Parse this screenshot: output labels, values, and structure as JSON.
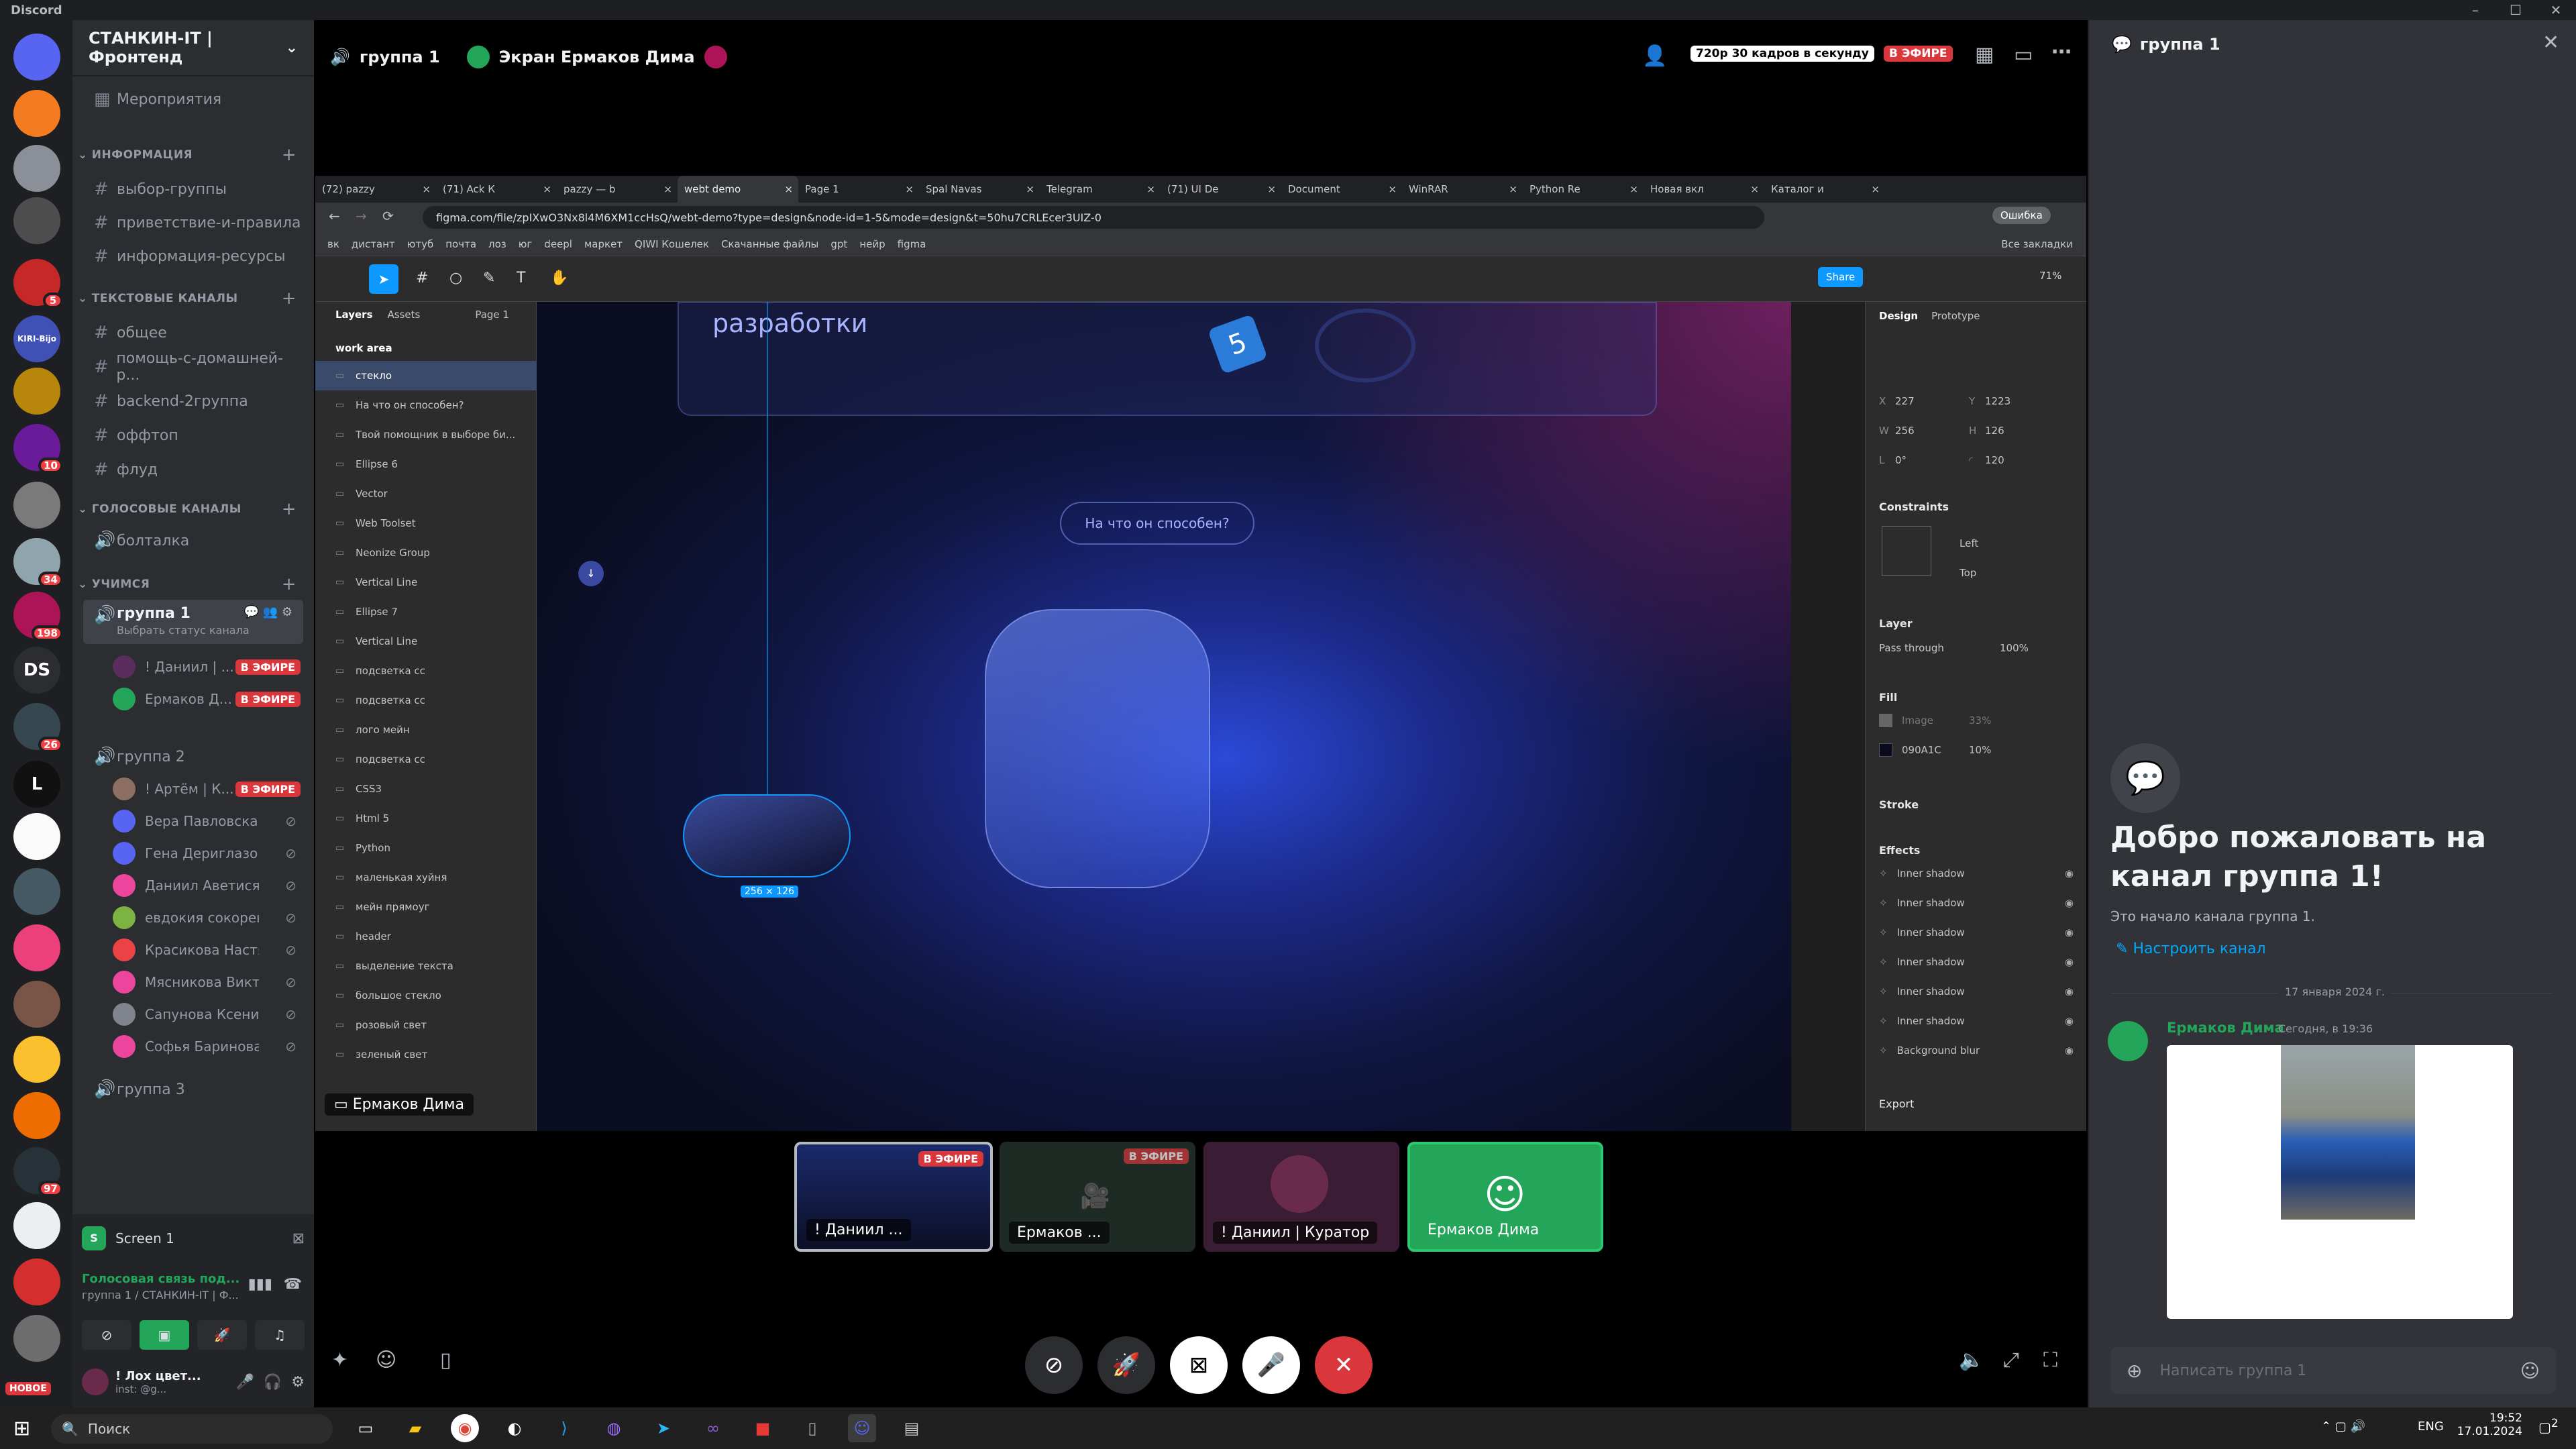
{
  "window": {
    "title": "Discord"
  },
  "colors": {
    "accent": "#5865f2",
    "live": "#da373c",
    "green": "#23a55a",
    "bg": "#313338"
  },
  "guilds": [
    {
      "label": "",
      "badge": "",
      "color": "#5865f2",
      "icon": "discord-icon"
    },
    {
      "label": "",
      "badge": "",
      "color": "#f47b20"
    },
    {
      "label": "",
      "badge": "",
      "color": "#8a8f98"
    },
    {
      "label": "",
      "badge": "",
      "color": "#4e4e4e"
    },
    {
      "label": "",
      "badge": "5",
      "color": "#c62828"
    },
    {
      "label": "KIRI-Bijo",
      "badge": "",
      "color": "#3f51b5"
    },
    {
      "label": "",
      "badge": "",
      "color": "#b8860b"
    },
    {
      "label": "",
      "badge": "10",
      "color": "#6a1b9a"
    },
    {
      "label": "",
      "badge": "",
      "color": "#7a7a7a"
    },
    {
      "label": "",
      "badge": "34",
      "color": "#90a4ae"
    },
    {
      "label": "",
      "badge": "198",
      "color": "#ad1457"
    },
    {
      "label": "DS",
      "badge": "",
      "color": "#2b2d31"
    },
    {
      "label": "",
      "badge": "26",
      "color": "#37474f"
    },
    {
      "label": "L",
      "badge": "",
      "color": "#111111"
    },
    {
      "label": "",
      "badge": "",
      "color": "#fafafa"
    },
    {
      "label": "",
      "badge": "",
      "color": "#455a64"
    },
    {
      "label": "",
      "badge": "",
      "color": "#ec407a"
    },
    {
      "label": "",
      "badge": "",
      "color": "#795548"
    },
    {
      "label": "",
      "badge": "",
      "color": "#fbc02d"
    },
    {
      "label": "",
      "badge": "",
      "color": "#ef6c00"
    },
    {
      "label": "",
      "badge": "97",
      "color": "#263238"
    },
    {
      "label": "",
      "badge": "",
      "color": "#eceff1"
    },
    {
      "label": "",
      "badge": "",
      "color": "#d32f2f"
    },
    {
      "label": "",
      "badge": "",
      "color": "#6d6d6d"
    }
  ],
  "new_label": "НОВОЕ",
  "server": {
    "name": "СТАНКИН-IT | Фронтенд",
    "events": "Мероприятия",
    "categories": {
      "info": "ИНФОРМАЦИЯ",
      "text": "ТЕКСТОВЫЕ КАНАЛЫ",
      "voice": "ГОЛОСОВЫЕ КАНАЛЫ",
      "study": "УЧИМСЯ"
    },
    "info_channels": [
      "выбор-группы",
      "приветствие-и-правила",
      "информация-ресурсы"
    ],
    "text_channels": [
      "общее",
      "помощь-с-домашней-р...",
      "backend-2группа",
      "оффтоп",
      "флуд"
    ],
    "voice_channels": [
      "болталка"
    ],
    "group1": {
      "name": "группа 1",
      "status": "Выбрать статус канала"
    },
    "group1_users": [
      {
        "name": "! Даниил | ...",
        "live": "В ЭФИРЕ",
        "color": "#5a2d5c"
      },
      {
        "name": "Ермаков Д...",
        "live": "В ЭФИРЕ",
        "color": "#23a55a"
      }
    ],
    "group2": {
      "name": "группа 2"
    },
    "group2_users": [
      {
        "name": "! Артём | К...",
        "live": "В ЭФИРЕ",
        "color": "#8d6e63"
      },
      {
        "name": "Вера Павловская",
        "live": "",
        "color": "#5865f2"
      },
      {
        "name": "Гена Дериглазов",
        "live": "",
        "color": "#5865f2"
      },
      {
        "name": "Даниил Аветисян",
        "live": "",
        "color": "#eb459e"
      },
      {
        "name": "евдокия сокоренко",
        "live": "",
        "color": "#7cb342"
      },
      {
        "name": "Красикова Настя",
        "live": "",
        "color": "#ed4245"
      },
      {
        "name": "Мясникова Виктор...",
        "live": "",
        "color": "#eb459e"
      },
      {
        "name": "Сапунова Ксения",
        "live": "",
        "color": "#80848e"
      },
      {
        "name": "Софья Баринова",
        "live": "",
        "color": "#eb459e"
      }
    ],
    "group3": {
      "name": "группа 3"
    }
  },
  "screen_panel": {
    "title": "Screen 1"
  },
  "voice_status": {
    "title": "Голосовая связь под...",
    "sub": "группа 1 / СТАНКИН-IT | Ф..."
  },
  "user_panel": {
    "name": "! Лох цвет...",
    "status": "inst: @g..."
  },
  "stage": {
    "channel": "группа 1",
    "screen_title": "Экран Ермаков Дима",
    "quality": "720p 30 кадров в секунду",
    "live": "В ЭФИРЕ",
    "streamer_tag": "Ермаков Дима"
  },
  "browser": {
    "tabs": [
      "(72) pazzy",
      "(71) Ack К",
      "pazzy — b",
      "webt demo",
      "Page 1",
      "Spal Navas",
      "Telegram",
      "(71) UI De",
      "Document",
      "WinRAR",
      "Python Re",
      "Новая вкл",
      "Каталог и"
    ],
    "url": "figma.com/file/zpIXwO3Nx8l4M6XM1ccHsQ/webt-demo?type=design&node-id=1-5&mode=design&t=50hu7CRLEcer3UIZ-0",
    "profile_btn": "Ошибка",
    "bookmarks": [
      "вк",
      "дистант",
      "ютуб",
      "почта",
      "лоз",
      "юг",
      "deepl",
      "маркет",
      "QIWI Кошелек",
      "Скачанные файлы",
      "gpt",
      "нейр",
      "figma"
    ],
    "all_bookmarks": "Все закладки"
  },
  "figma": {
    "tabs": {
      "layers": "Layers",
      "assets": "Assets",
      "page": "Page 1"
    },
    "frame": "work area",
    "layers": [
      "стекло",
      "На что он способен?",
      "Твой помощник в выборе би...",
      "Ellipse 6",
      "Vector",
      "Web Toolset",
      "Neonize Group",
      "Vertical Line",
      "Ellipse 7",
      "Vertical Line",
      "подсветка сс",
      "подсветка сс",
      "лого мейн",
      "подсветка сс",
      "CSS3",
      "Html 5",
      "Python",
      "маленькая хуйня",
      "мейн прямоуг",
      "header",
      "выделение текста",
      "большое стекло",
      "розовый свет",
      "зеленый свет"
    ],
    "share": "Share",
    "zoom": "71%",
    "canvas_heading": "разработки",
    "canvas_pill": "На что он способен?",
    "size_label": "256 × 126",
    "design_tabs": {
      "design": "Design",
      "prototype": "Prototype"
    },
    "x": "227",
    "y": "1223",
    "w": "256",
    "h": "126",
    "rot": "0°",
    "radius": "120",
    "constraints": {
      "title": "Constraints",
      "h": "Left",
      "v": "Top"
    },
    "layer": {
      "title": "Layer",
      "mode": "Pass through",
      "opacity": "100%"
    },
    "fill": {
      "title": "Fill",
      "image": "Image",
      "image_pct": "33%",
      "hex": "090A1C",
      "pct": "10%"
    },
    "stroke": "Stroke",
    "effects": {
      "title": "Effects",
      "items": [
        "Inner shadow",
        "Inner shadow",
        "Inner shadow",
        "Inner shadow",
        "Inner shadow",
        "Inner shadow",
        "Background blur"
      ]
    },
    "export": "Export"
  },
  "tiles": [
    {
      "name": "! Даниил ...",
      "live": "В ЭФИРЕ"
    },
    {
      "name": "Ермаков ...",
      "live": "В ЭФИРЕ"
    },
    {
      "name": "! Даниил | Куратор",
      "live": ""
    },
    {
      "name": "Ермаков Дима",
      "live": ""
    }
  ],
  "chat": {
    "channel": "группа 1",
    "welcome": "Добро пожаловать на канал группа 1!",
    "start": "Это начало канала группа 1.",
    "configure": "Настроить канал",
    "date": "17 января 2024 г.",
    "author": "Ермаков Дима",
    "time": "Сегодня, в 19:36",
    "placeholder": "Написать группа 1"
  },
  "taskbar": {
    "search": "Поиск",
    "lang": "ENG",
    "time": "19:52",
    "date": "17.01.2024",
    "notif": "2"
  }
}
